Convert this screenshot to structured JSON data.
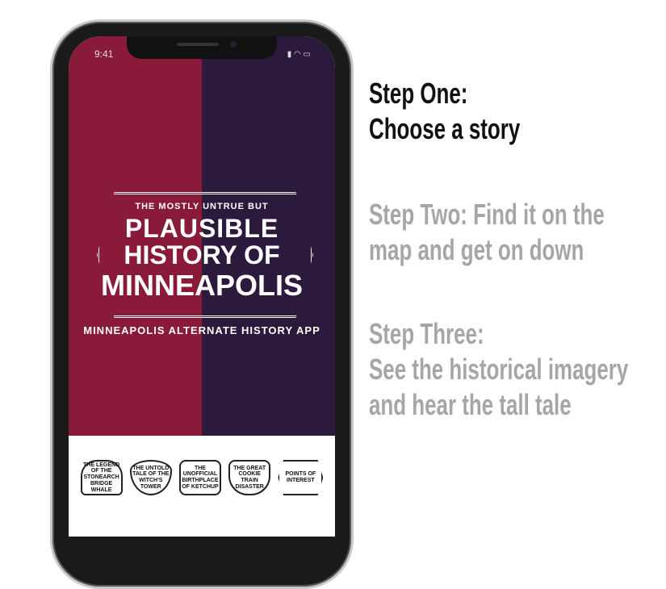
{
  "status_bar": {
    "time": "9:41",
    "icons": "signal-wifi-battery"
  },
  "app": {
    "logo_line1": "THE MOSTLY UNTRUE BUT",
    "logo_line2": "PLAUSIBLE",
    "logo_line3": "HISTORY OF",
    "logo_line4": "MINNEAPOLIS",
    "subtitle": "MINNEAPOLIS ALTERNATE HISTORY APP",
    "stories": [
      "THE LEGEND OF THE STONEARCH BRIDGE WHALE",
      "THE UNTOLD TALE OF THE WITCH'S TOWER",
      "THE UNOFFICIAL BIRTHPLACE OF KETCHUP",
      "THE GREAT COOKIE TRAIN DISASTER",
      "POINTS OF INTEREST"
    ]
  },
  "steps": [
    {
      "line1": "Step One:",
      "line2": "Choose a story"
    },
    {
      "line1": "Step Two: Find it on the",
      "line2": "map and get on down"
    },
    {
      "line1": "Step Three:",
      "line2": "See the historical imagery",
      "line3": "and hear the tall tale"
    }
  ],
  "colors": {
    "red": "#8a1a3a",
    "purple": "#2c1a3c",
    "active_step": "#111111",
    "inactive_step": "#a6a6a6"
  }
}
